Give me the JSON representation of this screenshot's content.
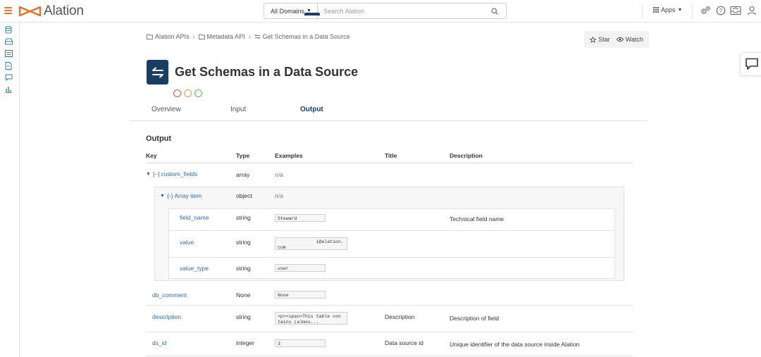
{
  "brand": {
    "name": "Alation",
    "color": "#e8702a"
  },
  "search": {
    "domain_filter": "All Domains",
    "placeholder": "Search Alation"
  },
  "header": {
    "apps_label": "Apps"
  },
  "breadcrumb": [
    "Alation APIs",
    "Metadata API",
    "Get Schemas in a Data Source"
  ],
  "actions": {
    "star": "Star",
    "watch": "Watch"
  },
  "page": {
    "title": "Get Schemas in a Data Source",
    "icon": "swap-arrows-icon",
    "accent": "#183e63"
  },
  "status_circles": [
    "#d9534f",
    "#e89b3c",
    "#5cb85c"
  ],
  "tabs": [
    "Overview",
    "Input",
    "Output"
  ],
  "active_tab": "Output",
  "output": {
    "section_title": "Output",
    "columns": [
      "Key",
      "Type",
      "Examples",
      "Title",
      "Description"
    ],
    "rows": [
      {
        "key": "custom_fields",
        "type": "array",
        "example": "n/a",
        "title": "",
        "description": ""
      },
      {
        "key": "Array item",
        "type": "object",
        "example": "n/a",
        "title": "",
        "description": ""
      },
      {
        "key": "field_name",
        "type": "string",
        "example": "Steward",
        "title": "",
        "description": "Technical field name"
      },
      {
        "key": "value",
        "type": "string",
        "example": "              i@alation.\ncom",
        "title": "",
        "description": ""
      },
      {
        "key": "value_type",
        "type": "string",
        "example": "user",
        "title": "",
        "description": ""
      },
      {
        "key": "db_comment",
        "type": "None",
        "example": "None",
        "title": "",
        "description": ""
      },
      {
        "key": "description",
        "type": "string",
        "example": "<p><span>This table con\ntains (almos...",
        "title": "Description",
        "description": "Description of field"
      },
      {
        "key": "ds_id",
        "type": "integer",
        "example": "3",
        "title": "Data source id",
        "description": "Unique identifier of the data source inside Alation"
      }
    ]
  }
}
